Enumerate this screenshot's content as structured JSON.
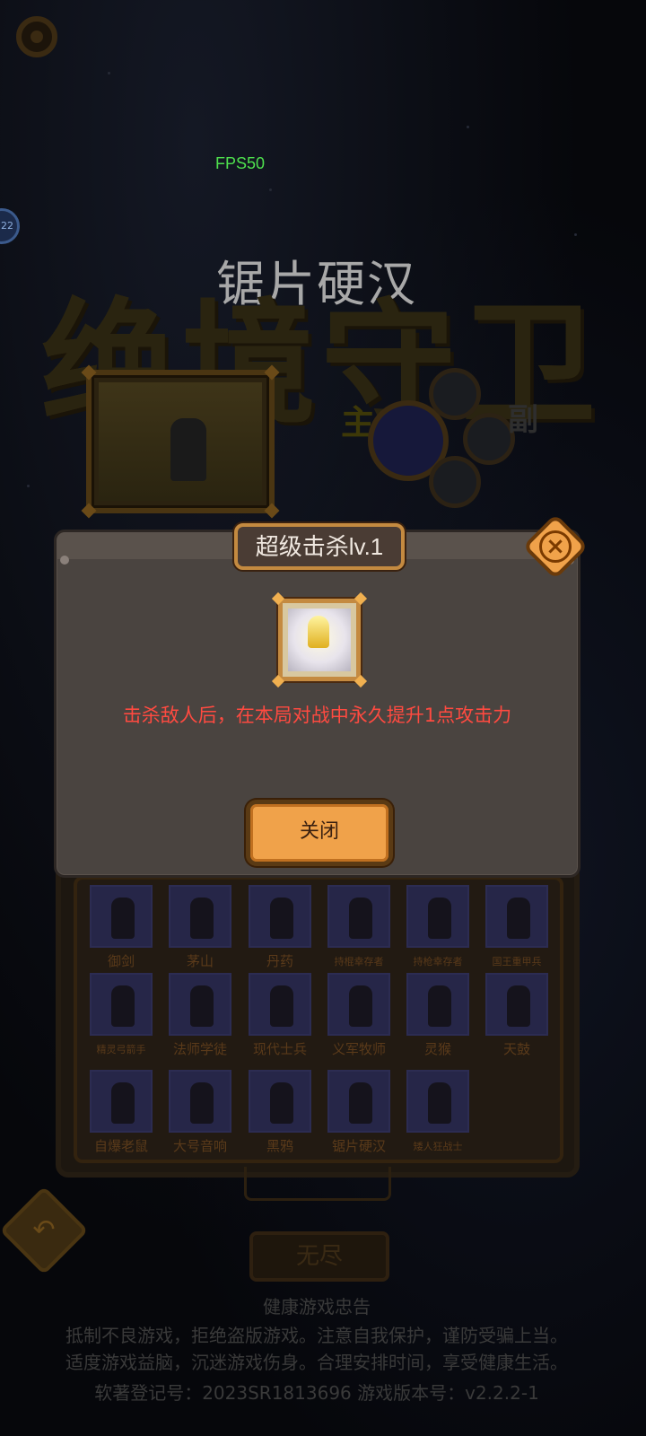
{
  "hud": {
    "fps": "FPS50",
    "side_badge": "22"
  },
  "hero": {
    "name": "锯片硬汉",
    "slot_main_label": "主",
    "slot_sub_label": "副"
  },
  "background_title": "绝境守卫",
  "modal": {
    "title": "超级击杀lv.1",
    "description": "击杀敌人后，在本局对战中永久提升1点攻击力",
    "close_label": "关闭"
  },
  "roster": [
    {
      "name": "御剑",
      "small": false
    },
    {
      "name": "茅山",
      "small": false
    },
    {
      "name": "丹药",
      "small": false
    },
    {
      "name": "持棍幸存者",
      "small": true
    },
    {
      "name": "持枪幸存者",
      "small": true
    },
    {
      "name": "国王重甲兵",
      "small": true
    },
    {
      "name": "精灵弓箭手",
      "small": true
    },
    {
      "name": "法师学徒",
      "small": false
    },
    {
      "name": "现代士兵",
      "small": false
    },
    {
      "name": "义军牧师",
      "small": false
    },
    {
      "name": "灵猴",
      "small": false
    },
    {
      "name": "天鼓",
      "small": false
    },
    {
      "name": "自爆老鼠",
      "small": false
    },
    {
      "name": "大号音响",
      "small": false
    },
    {
      "name": "黑鸦",
      "small": false
    },
    {
      "name": "锯片硬汉",
      "small": false
    },
    {
      "name": "矮人狂战士",
      "small": true
    }
  ],
  "buttons": {
    "back_icon": "undo-arrow-icon",
    "endless_label": "无尽"
  },
  "footer": {
    "line1": "健康游戏忠告",
    "line2": "抵制不良游戏，拒绝盗版游戏。注意自我保护，谨防受骗上当。",
    "line3": "适度游戏益脑，沉迷游戏伤身。合理安排时间，享受健康生活。",
    "line4": "软著登记号：2023SR1813696   游戏版本号：v2.2.2-1"
  },
  "colors": {
    "accent_orange": "#f0a24a",
    "desc_red": "#ff4a40",
    "fps_green": "#4ee04e"
  }
}
